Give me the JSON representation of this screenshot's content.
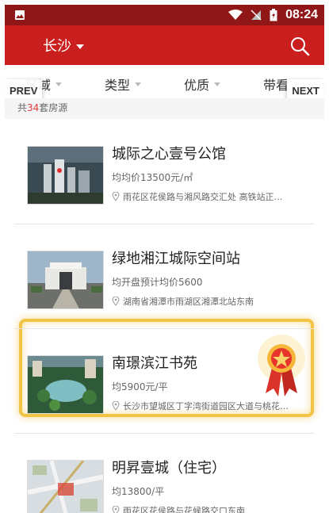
{
  "status_bar": {
    "time": "08:24"
  },
  "app_bar": {
    "city": "长沙"
  },
  "filters": [
    {
      "label": "区域"
    },
    {
      "label": "类型"
    },
    {
      "label": "优质"
    },
    {
      "label": "带看"
    }
  ],
  "pager": {
    "prev": "PREV",
    "next": "NEXT"
  },
  "count": {
    "prefix": "共",
    "number": "34",
    "suffix": "套房源"
  },
  "listings": [
    {
      "title": "城际之心壹号公馆",
      "price": "均均价13500元/㎡",
      "address": "雨花区花侯路与湘风路交汇处 高铁站正…",
      "featured": false
    },
    {
      "title": "绿地湘江城际空间站",
      "price": "均开盘预计均价5600",
      "address": "湖南省湘潭市雨湖区湘潭北站东南",
      "featured": false
    },
    {
      "title": "南璟滨江书苑",
      "price": "均5900元/平",
      "address": "长沙市望城区丁字湾街道园区大道与桃花…",
      "featured": true
    },
    {
      "title": "明昇壹城（住宅）",
      "price": "均13800/平",
      "address": "雨花区花侯路与花候路交口东南",
      "featured": false
    }
  ],
  "colors": {
    "status_bar": "#8f1717",
    "app_bar": "#c9201f",
    "accent": "#e4393c",
    "gold": "#f2c443"
  },
  "icons": {
    "status_left": "image-icon",
    "wifi": "wifi-icon",
    "signal": "no-signal-icon",
    "battery": "battery-charging-icon",
    "search": "search-icon",
    "location": "location-pin-icon",
    "badge": "medal-badge-icon"
  }
}
